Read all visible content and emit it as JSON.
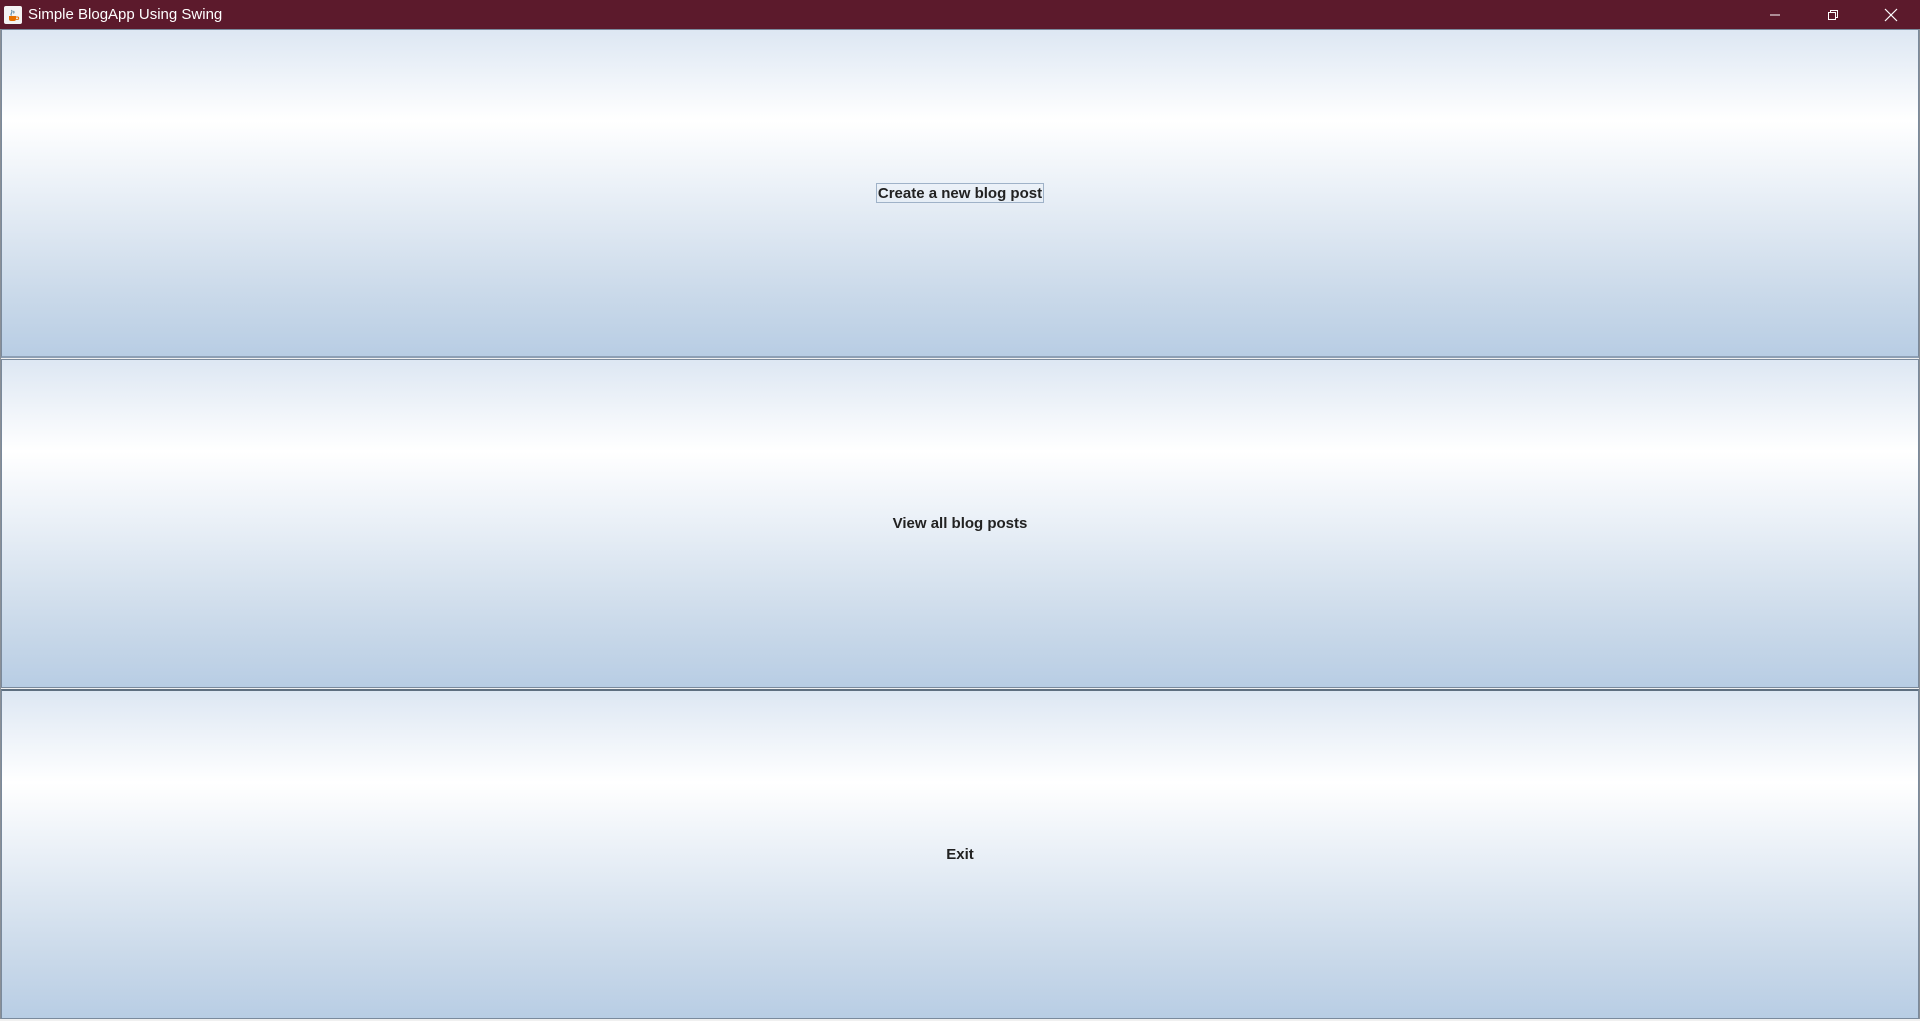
{
  "window": {
    "title": "Simple BlogApp Using Swing",
    "titlebar_color": "#5c1a2c",
    "icon": "java-cup-icon"
  },
  "title_controls": {
    "minimize_icon": "minimize-icon",
    "restore_icon": "restore-icon",
    "close_icon": "close-icon"
  },
  "buttons": [
    {
      "label": "Create a new blog post",
      "focused": true
    },
    {
      "label": "View all blog posts",
      "focused": false
    },
    {
      "label": "Exit",
      "focused": false
    }
  ]
}
